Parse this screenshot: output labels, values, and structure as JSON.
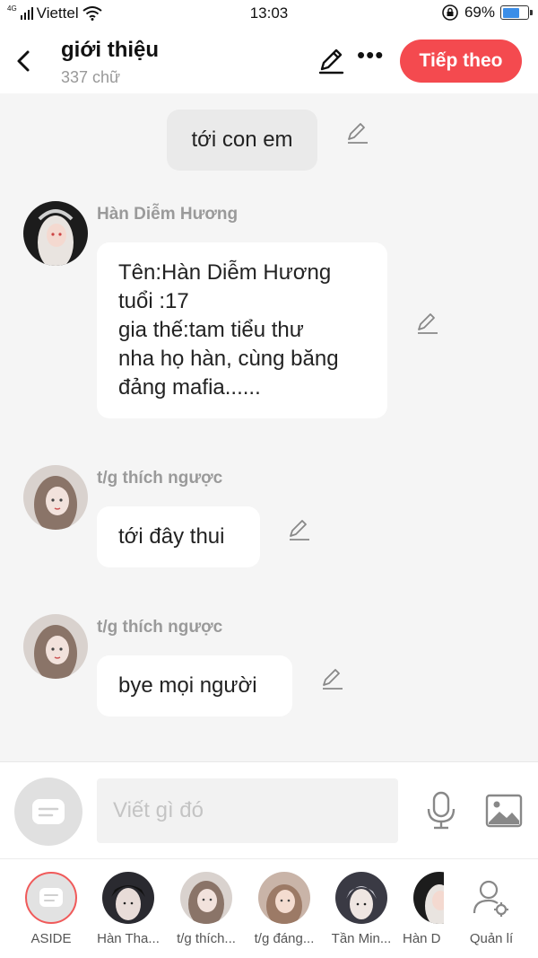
{
  "status_bar": {
    "network": "4G",
    "carrier": "Viettel",
    "time": "13:03",
    "battery": "69%",
    "battery_level": 0.69
  },
  "header": {
    "title": "giới thiệu",
    "subtitle": "337 chữ",
    "next_label": "Tiếp theo"
  },
  "messages": [
    {
      "type": "narration",
      "text": "tới con em"
    },
    {
      "type": "character",
      "name": "Hàn Diễm Hương",
      "lines": [
        "Tên:Hàn Diễm Hương",
        "tuổi :17",
        "gia thế:tam tiểu thư",
        "nha họ hàn, cùng băng",
        "đảng mafia......"
      ]
    },
    {
      "type": "character",
      "name": "t/g thích ngược",
      "lines": [
        "tới đây thui"
      ]
    },
    {
      "type": "character",
      "name": "t/g thích ngược",
      "lines": [
        "bye mọi người"
      ]
    }
  ],
  "composer": {
    "placeholder": "Viết gì đó"
  },
  "characters": [
    {
      "label": "ASIDE"
    },
    {
      "label": "Hàn Tha..."
    },
    {
      "label": "t/g thích..."
    },
    {
      "label": "t/g đáng..."
    },
    {
      "label": "Tần Min..."
    },
    {
      "label": "Hàn D"
    },
    {
      "label": "Quản lí"
    }
  ],
  "colors": {
    "accent": "#f44a4f",
    "battery": "#3b8ee8"
  },
  "icons": [
    "back-icon",
    "edit-icon",
    "more-icon",
    "pencil-icon",
    "mic-icon",
    "image-icon",
    "user-settings-icon"
  ]
}
